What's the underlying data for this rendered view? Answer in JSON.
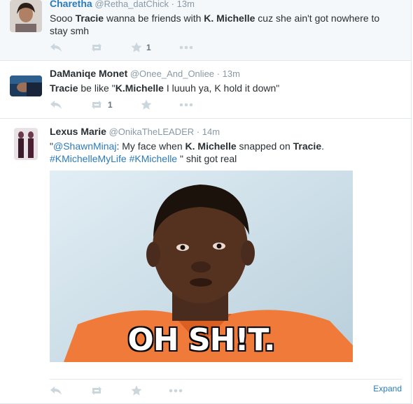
{
  "tweets": [
    {
      "name": "Charetha",
      "handle": "@Retha_datChick",
      "time": "13m",
      "text_parts": [
        "Sooo ",
        "Tracie",
        " wanna be friends with ",
        "K. Michelle",
        " cuz she ain't got nowhere to stay smh"
      ],
      "retweets": "",
      "favorites": "1"
    },
    {
      "name": "DaManiqe Monet",
      "handle": "@Onee_And_Onliee",
      "time": "13m",
      "text_parts": [
        "Tracie",
        " be like \"",
        "K.Michelle",
        " I luuuh ya, K hold it down\""
      ],
      "retweets": "1",
      "favorites": ""
    },
    {
      "name": "Lexus Marie",
      "handle": "@OnikaTheLEADER",
      "time": "14m",
      "text_parts": [
        "\"",
        "@ShawnMinaj",
        ": My face when ",
        "K. Michelle",
        " snapped on ",
        "Tracie",
        ".",
        "#KMichelleMyLife",
        " ",
        "#KMichelle",
        " \" shit got real"
      ],
      "photo_caption": "OH SH!T.",
      "expand": "Expand",
      "retweets": "",
      "favorites": ""
    }
  ],
  "separator": "·",
  "icons": {
    "reply": "reply-icon",
    "retweet": "retweet-icon",
    "favorite": "star-icon",
    "more": "more-icon"
  },
  "colors": {
    "link": "#2b7bb9",
    "muted": "#8899a6",
    "icon": "#ccd6dd",
    "selected_bg": "#f5f8fa"
  }
}
